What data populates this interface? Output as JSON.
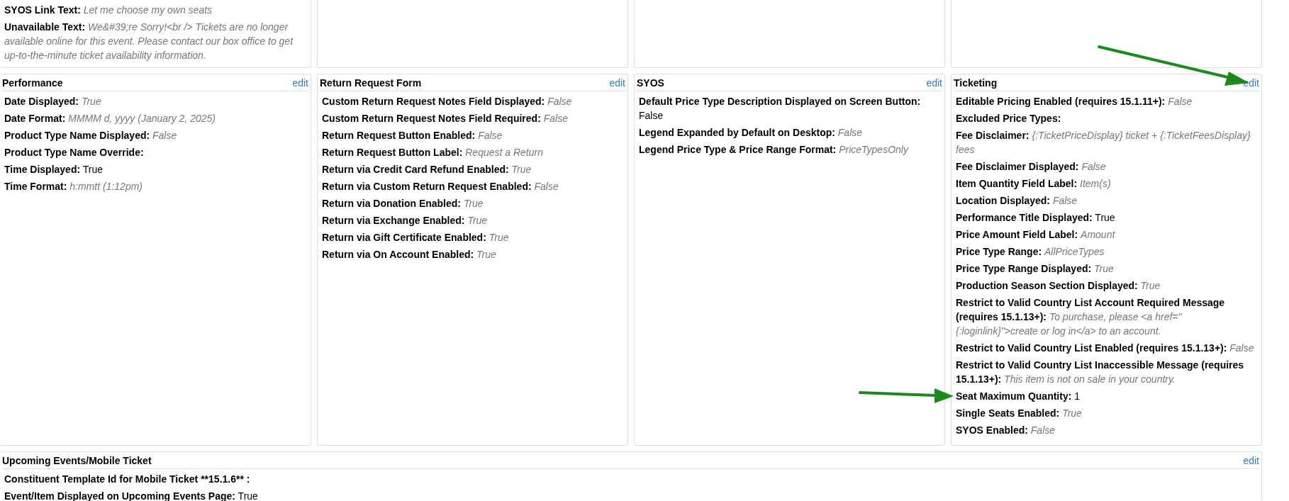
{
  "top_cards": [
    {
      "rows": [
        {
          "label": "SYOS Link Text:",
          "value": "Let me choose my own seats",
          "default": true
        },
        {
          "label": "Unavailable Text:",
          "value": "We&#39;re Sorry!<br /> Tickets are no longer available online for this event. Please contact our box office to get up-to-the-minute ticket availability information.",
          "default": true
        }
      ]
    }
  ],
  "sections": [
    {
      "title": "Performance",
      "edit": "edit",
      "rows": [
        {
          "label": "Date Displayed:",
          "value": "True",
          "default": true
        },
        {
          "label": "Date Format:",
          "value": "MMMM d, yyyy (January 2, 2025)",
          "default": true
        },
        {
          "label": "Product Type Name Displayed:",
          "value": "False",
          "default": true
        },
        {
          "label": "Product Type Name Override:"
        },
        {
          "label": "Time Displayed:",
          "value": "True",
          "default": false
        },
        {
          "label": "Time Format:",
          "value": "h:mmtt (1:12pm)",
          "default": true
        }
      ]
    },
    {
      "title": "Return Request Form",
      "edit": "edit",
      "rows": [
        {
          "label": "Custom Return Request Notes Field Displayed:",
          "value": "False",
          "default": true
        },
        {
          "label": "Custom Return Request Notes Field Required:",
          "value": "False",
          "default": true
        },
        {
          "label": "Return Request Button Enabled:",
          "value": "False",
          "default": true
        },
        {
          "label": "Return Request Button Label:",
          "value": "Request a Return",
          "default": true
        },
        {
          "label": "Return via Credit Card Refund Enabled:",
          "value": "True",
          "default": true
        },
        {
          "label": "Return via Custom Return Request Enabled:",
          "value": "False",
          "default": true
        },
        {
          "label": "Return via Donation Enabled:",
          "value": "True",
          "default": true
        },
        {
          "label": "Return via Exchange Enabled:",
          "value": "True",
          "default": true
        },
        {
          "label": "Return via Gift Certificate Enabled:",
          "value": "True",
          "default": true
        },
        {
          "label": "Return via On Account Enabled:",
          "value": "True",
          "default": true
        }
      ]
    },
    {
      "title": "SYOS",
      "edit": "edit",
      "rows": [
        {
          "label": "Default Price Type Description Displayed on Screen Button:",
          "value": "False",
          "default": false
        },
        {
          "label": "Legend Expanded by Default on Desktop:",
          "value": "False",
          "default": true
        },
        {
          "label": "Legend Price Type & Price Range Format:",
          "value": "PriceTypesOnly",
          "default": true
        }
      ]
    },
    {
      "title": "Ticketing",
      "edit": "edit",
      "rows": [
        {
          "label": "Editable Pricing Enabled (requires 15.1.11+):",
          "value": "False",
          "default": true
        },
        {
          "label": "Excluded Price Types:"
        },
        {
          "label": "Fee Disclaimer:",
          "value": "{:TicketPriceDisplay} ticket + {:TicketFeesDisplay} fees",
          "default": true
        },
        {
          "label": "Fee Disclaimer Displayed:",
          "value": "False",
          "default": true
        },
        {
          "label": "Item Quantity Field Label:",
          "value": "Item(s)",
          "default": true
        },
        {
          "label": "Location Displayed:",
          "value": "False",
          "default": true
        },
        {
          "label": "Performance Title Displayed:",
          "value": "True",
          "default": false
        },
        {
          "label": "Price Amount Field Label:",
          "value": "Amount",
          "default": true
        },
        {
          "label": "Price Type Range:",
          "value": "AllPriceTypes",
          "default": true
        },
        {
          "label": "Price Type Range Displayed:",
          "value": "True",
          "default": true
        },
        {
          "label": "Production Season Section Displayed:",
          "value": "True",
          "default": true
        },
        {
          "label": "Restrict to Valid Country List Account Required Message (requires 15.1.13+):",
          "value": "To purchase, please <a href=\"{:loginlink}\">create or log in</a> to an account.",
          "default": true
        },
        {
          "label": "Restrict to Valid Country List Enabled (requires 15.1.13+):",
          "value": "False",
          "default": true
        },
        {
          "label": "Restrict to Valid Country List Inaccessible Message (requires 15.1.13+):",
          "value": "This item is not on sale in your country.",
          "default": true
        },
        {
          "label": "Seat Maximum Quantity:",
          "value": "1",
          "default": false
        },
        {
          "label": "Single Seats Enabled:",
          "value": "True",
          "default": true
        },
        {
          "label": "SYOS Enabled:",
          "value": "False",
          "default": true
        }
      ]
    }
  ],
  "bottom_section": {
    "title": "Upcoming Events/Mobile Ticket",
    "edit": "edit",
    "rows": [
      {
        "label": "Constituent Template Id for Mobile Ticket **15.1.6** :"
      },
      {
        "label": "Event/Item Displayed on Upcoming Events Page:",
        "value": "True",
        "default": false
      }
    ]
  }
}
